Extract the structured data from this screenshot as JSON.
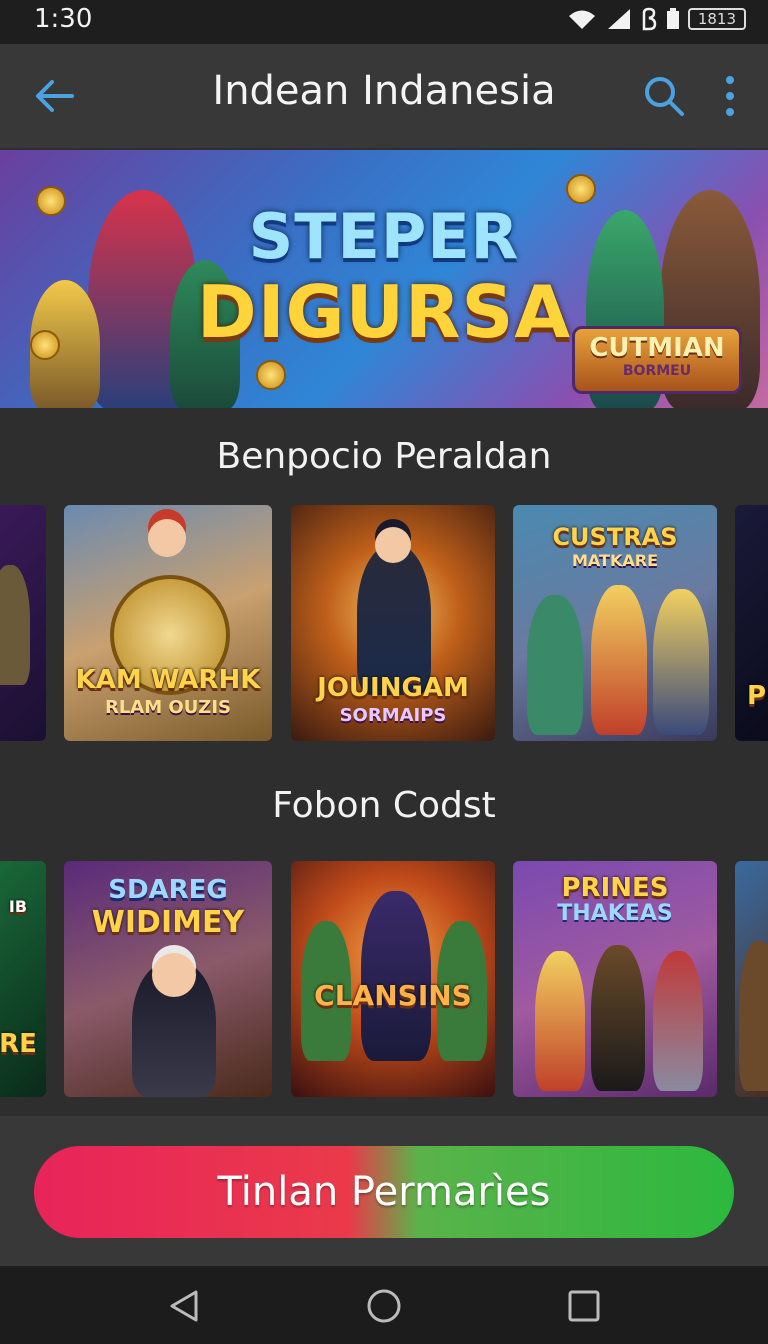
{
  "status_bar": {
    "time": "1:30",
    "battery_label": "1813"
  },
  "app_bar": {
    "title": "Indean Indanesia"
  },
  "hero_banner": {
    "title_line1": "STEPER",
    "title_line2": "DIGURSA",
    "badge_line1": "CUTMIAN",
    "badge_line2": "BORMEU"
  },
  "section1": {
    "title": "Benpocio Peraldan",
    "cards": [
      {
        "line1": "",
        "line2": ""
      },
      {
        "line1": "KAM WARHK",
        "line2": "RLAM OUZIS"
      },
      {
        "line1": "JOUINGAM",
        "line2": "SORMAIPS"
      },
      {
        "line1": "CUSTRAS",
        "line2": "MATKARE"
      },
      {
        "line1": "P",
        "line2": ""
      }
    ]
  },
  "section2": {
    "title": "Fobon Codst",
    "cards": [
      {
        "line1": "IB",
        "line2": "RE"
      },
      {
        "line1": "SDAREG",
        "line2": "WIDIMEY"
      },
      {
        "line1": "CLANSINS",
        "line2": ""
      },
      {
        "line1": "PRINES",
        "line2": "THAKEAS"
      },
      {
        "line1": "",
        "line2": ""
      }
    ]
  },
  "cta": {
    "label": "Tinlan Permarìes"
  },
  "colors": {
    "accent_blue": "#4aa3e0",
    "cta_left": "#e8245a",
    "cta_right": "#2cb83e",
    "title_gold": "#ffd43a"
  }
}
